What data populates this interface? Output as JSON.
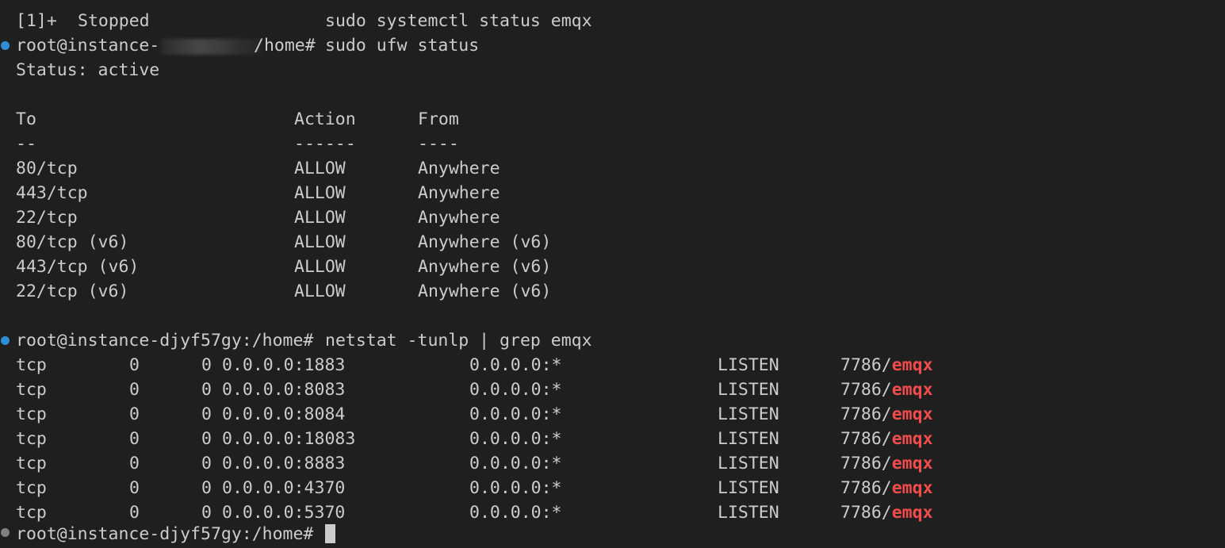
{
  "stopped_line": {
    "job": "[1]+",
    "state": "Stopped",
    "command": "sudo systemctl status emqx"
  },
  "prompt1": {
    "user_host": "root@instance-",
    "cwd": "/home#",
    "command": "sudo ufw status"
  },
  "status_line": "Status: active",
  "ufw": {
    "headers": {
      "to": "To",
      "action": "Action",
      "from": "From"
    },
    "separators": {
      "to": "--",
      "action": "------",
      "from": "----"
    },
    "rules": [
      {
        "to": "80/tcp",
        "action": "ALLOW",
        "from": "Anywhere"
      },
      {
        "to": "443/tcp",
        "action": "ALLOW",
        "from": "Anywhere"
      },
      {
        "to": "22/tcp",
        "action": "ALLOW",
        "from": "Anywhere"
      },
      {
        "to": "80/tcp (v6)",
        "action": "ALLOW",
        "from": "Anywhere (v6)"
      },
      {
        "to": "443/tcp (v6)",
        "action": "ALLOW",
        "from": "Anywhere (v6)"
      },
      {
        "to": "22/tcp (v6)",
        "action": "ALLOW",
        "from": "Anywhere (v6)"
      }
    ]
  },
  "prompt2": {
    "prompt": "root@instance-djyf57gy:/home#",
    "command": "netstat -tunlp | grep emqx"
  },
  "netstat": [
    {
      "proto": "tcp",
      "recv": "0",
      "send": "0",
      "local": "0.0.0.0:1883",
      "foreign": "0.0.0.0:*",
      "state": "LISTEN",
      "pid": "7786/",
      "prog": "emqx"
    },
    {
      "proto": "tcp",
      "recv": "0",
      "send": "0",
      "local": "0.0.0.0:8083",
      "foreign": "0.0.0.0:*",
      "state": "LISTEN",
      "pid": "7786/",
      "prog": "emqx"
    },
    {
      "proto": "tcp",
      "recv": "0",
      "send": "0",
      "local": "0.0.0.0:8084",
      "foreign": "0.0.0.0:*",
      "state": "LISTEN",
      "pid": "7786/",
      "prog": "emqx"
    },
    {
      "proto": "tcp",
      "recv": "0",
      "send": "0",
      "local": "0.0.0.0:18083",
      "foreign": "0.0.0.0:*",
      "state": "LISTEN",
      "pid": "7786/",
      "prog": "emqx"
    },
    {
      "proto": "tcp",
      "recv": "0",
      "send": "0",
      "local": "0.0.0.0:8883",
      "foreign": "0.0.0.0:*",
      "state": "LISTEN",
      "pid": "7786/",
      "prog": "emqx"
    },
    {
      "proto": "tcp",
      "recv": "0",
      "send": "0",
      "local": "0.0.0.0:4370",
      "foreign": "0.0.0.0:*",
      "state": "LISTEN",
      "pid": "7786/",
      "prog": "emqx"
    },
    {
      "proto": "tcp",
      "recv": "0",
      "send": "0",
      "local": "0.0.0.0:5370",
      "foreign": "0.0.0.0:*",
      "state": "LISTEN",
      "pid": "7786/",
      "prog": "emqx"
    }
  ],
  "prompt3": {
    "prompt": "root@instance-djyf57gy:/home#"
  },
  "colors": {
    "background": "#1f1f1f",
    "foreground": "#cccccc",
    "highlight": "#f14c4c",
    "prompt_dot": "#2f8fd6"
  }
}
